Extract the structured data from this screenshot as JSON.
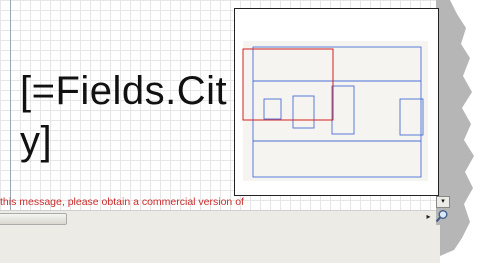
{
  "report_field": {
    "text": "[=Fields.Cit\ny]"
  },
  "watermark": {
    "text": "this message, please obtain a commercial version of"
  },
  "icons": {
    "scroll_right": "triangle-right-icon",
    "scroll_down": "triangle-down-icon",
    "zoom": "magnifier-icon"
  },
  "glyphs": {
    "arrow_right": "▸",
    "arrow_down": "▾"
  },
  "colors": {
    "watermark": "#cc2b2b",
    "navigator_outline": "#4a6fd8",
    "navigator_viewport": "#d22222",
    "navigator_page": "#f6f4f0"
  }
}
